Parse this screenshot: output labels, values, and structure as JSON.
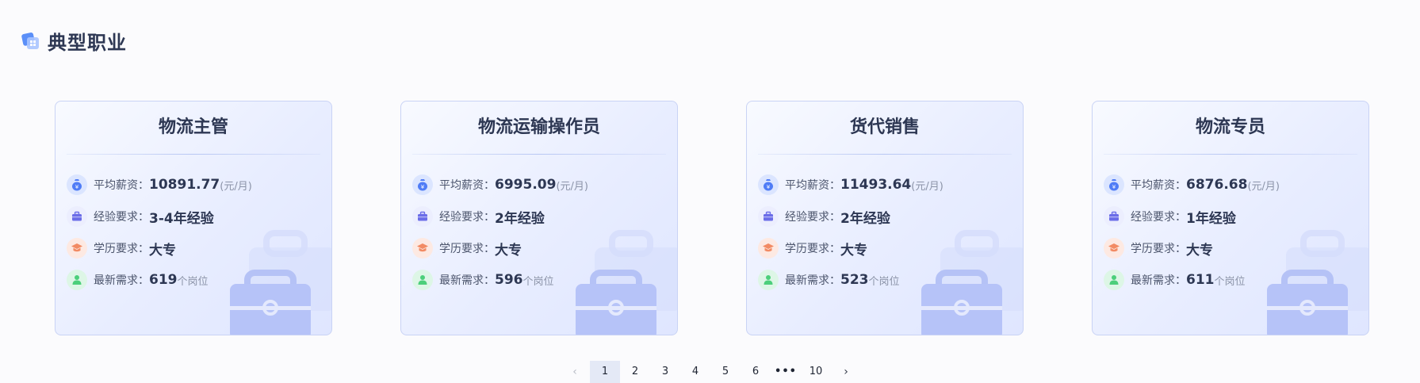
{
  "section": {
    "title": "典型职业"
  },
  "labels": {
    "salary": "平均薪资：",
    "experience": "经验要求：",
    "education": "学历要求：",
    "demand": "最新需求："
  },
  "units": {
    "salary": "(元/月)",
    "demand": "个岗位"
  },
  "cards": [
    {
      "title": "物流主管",
      "salary": "10891.77",
      "experience": "3-4年经验",
      "education": "大专",
      "demand": "619"
    },
    {
      "title": "物流运输操作员",
      "salary": "6995.09",
      "experience": "2年经验",
      "education": "大专",
      "demand": "596"
    },
    {
      "title": "货代销售",
      "salary": "11493.64",
      "experience": "2年经验",
      "education": "大专",
      "demand": "523"
    },
    {
      "title": "物流专员",
      "salary": "6876.68",
      "experience": "1年经验",
      "education": "大专",
      "demand": "611"
    }
  ],
  "pagination": {
    "prev": "‹",
    "pages": [
      "1",
      "2",
      "3",
      "4",
      "5",
      "6"
    ],
    "ellipsis": "•••",
    "last": "10",
    "next": "›",
    "current": "1"
  },
  "colors": {
    "salary_icon": "#4f7cf6",
    "experience_icon": "#6b6de8",
    "education_icon": "#f28b64",
    "demand_icon": "#4ccf7b"
  }
}
